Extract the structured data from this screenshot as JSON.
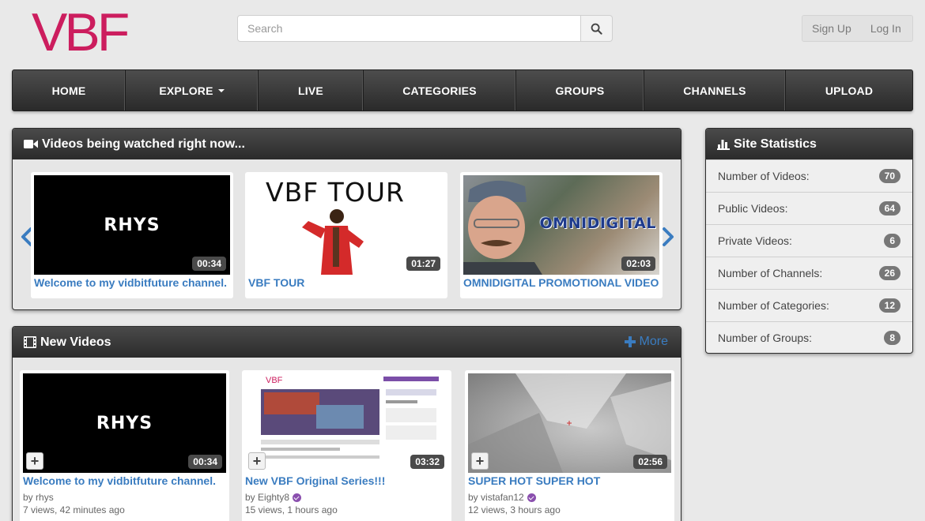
{
  "brand": {
    "logo_text": "VBF",
    "logo_color": "#cc1d5e"
  },
  "search": {
    "placeholder": "Search"
  },
  "auth": {
    "signup": "Sign Up",
    "login": "Log In"
  },
  "nav": {
    "home": "HOME",
    "explore": "EXPLORE",
    "live": "LIVE",
    "categories": "CATEGORIES",
    "groups": "GROUPS",
    "channels": "CHANNELS",
    "upload": "UPLOAD"
  },
  "watching": {
    "title": "Videos being watched right now...",
    "videos": [
      {
        "thumb_text": "RHYS",
        "duration": "00:34",
        "title": "Welcome to my vidbitfuture channel."
      },
      {
        "thumb_text": "VBF TOUR",
        "duration": "01:27",
        "title": "VBF TOUR"
      },
      {
        "thumb_text": "OMNIDIGITAL",
        "duration": "02:03",
        "title": "OMNIDIGITAL PROMOTIONAL VIDEO"
      }
    ]
  },
  "new_videos": {
    "title": "New Videos",
    "more": "More",
    "videos": [
      {
        "thumb_text": "RHYS",
        "duration": "00:34",
        "title": "Welcome to my vidbitfuture channel.",
        "by": "by",
        "author": "rhys",
        "stats": "7 views, 42 minutes ago"
      },
      {
        "duration": "03:32",
        "title": "New VBF Original Series!!!",
        "by": "by",
        "author": "Eighty8",
        "stats": "15 views, 1 hours ago"
      },
      {
        "duration": "02:56",
        "title": "SUPER HOT SUPER HOT",
        "by": "by",
        "author": "vistafan12",
        "stats": "12 views, 3 hours ago"
      }
    ]
  },
  "stats": {
    "title": "Site Statistics",
    "rows": [
      {
        "label": "Number of Videos:",
        "value": "70"
      },
      {
        "label": "Public Videos:",
        "value": "64"
      },
      {
        "label": "Private Videos:",
        "value": "6"
      },
      {
        "label": "Number of Channels:",
        "value": "26"
      },
      {
        "label": "Number of Categories:",
        "value": "12"
      },
      {
        "label": "Number of Groups:",
        "value": "8"
      }
    ]
  },
  "colors": {
    "link": "#3a7cc0",
    "nav_bg": "#333333",
    "badge": "#777777",
    "verified": "#8a4fae"
  }
}
